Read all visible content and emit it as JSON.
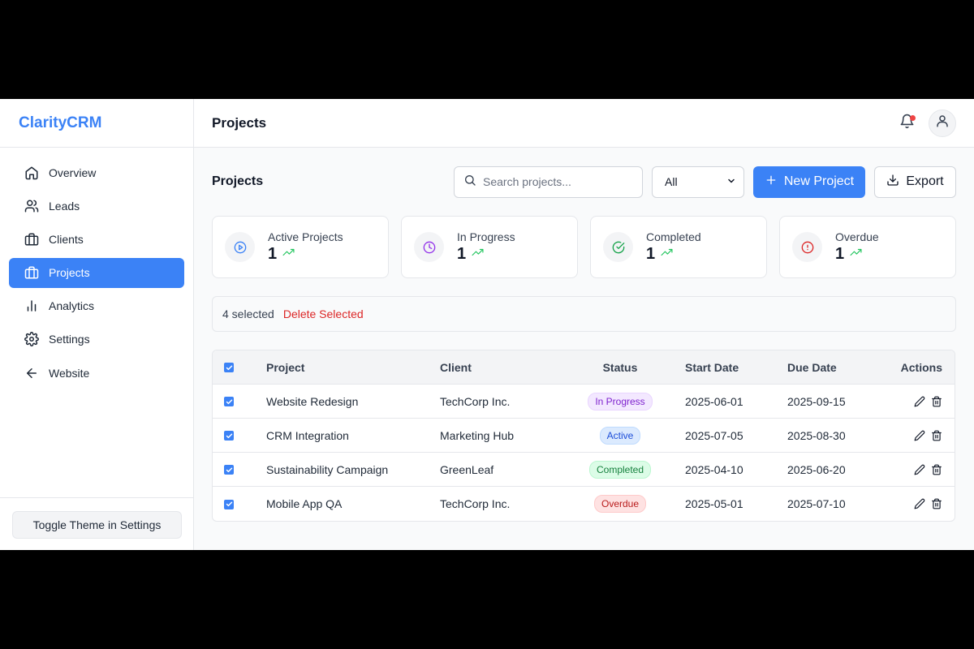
{
  "brand": "ClarityCRM",
  "nav": [
    {
      "label": "Overview",
      "icon": "home-icon"
    },
    {
      "label": "Leads",
      "icon": "users-icon"
    },
    {
      "label": "Clients",
      "icon": "briefcase-icon"
    },
    {
      "label": "Projects",
      "icon": "briefcase-icon",
      "active": true
    },
    {
      "label": "Analytics",
      "icon": "bar-chart-icon"
    },
    {
      "label": "Settings",
      "icon": "gear-icon"
    },
    {
      "label": "Website",
      "icon": "arrow-left-icon"
    }
  ],
  "sidebar_footer": {
    "theme_button": "Toggle Theme in Settings"
  },
  "header": {
    "title": "Projects"
  },
  "toolbar": {
    "title": "Projects",
    "search_placeholder": "Search projects...",
    "filter_value": "All",
    "new_project": "New Project",
    "export": "Export"
  },
  "stats": [
    {
      "label": "Active Projects",
      "value": "1",
      "icon": "play-circle-icon",
      "color": "#3b82f6"
    },
    {
      "label": "In Progress",
      "value": "1",
      "icon": "clock-icon",
      "color": "#9333ea"
    },
    {
      "label": "Completed",
      "value": "1",
      "icon": "check-circle-icon",
      "color": "#16a34a"
    },
    {
      "label": "Overdue",
      "value": "1",
      "icon": "alert-circle-icon",
      "color": "#dc2626"
    }
  ],
  "selection": {
    "count_text": "4 selected",
    "delete_label": "Delete Selected"
  },
  "table": {
    "headers": {
      "project": "Project",
      "client": "Client",
      "status": "Status",
      "start": "Start Date",
      "due": "Due Date",
      "actions": "Actions"
    },
    "rows": [
      {
        "project": "Website Redesign",
        "client": "TechCorp Inc.",
        "status": "In Progress",
        "start": "2025-06-01",
        "due": "2025-09-15"
      },
      {
        "project": "CRM Integration",
        "client": "Marketing Hub",
        "status": "Active",
        "start": "2025-07-05",
        "due": "2025-08-30"
      },
      {
        "project": "Sustainability Campaign",
        "client": "GreenLeaf",
        "status": "Completed",
        "start": "2025-04-10",
        "due": "2025-06-20"
      },
      {
        "project": "Mobile App QA",
        "client": "TechCorp Inc.",
        "status": "Overdue",
        "start": "2025-05-01",
        "due": "2025-07-10"
      }
    ]
  },
  "colors": {
    "accent": "#3b82f6",
    "danger": "#dc2626",
    "trend": "#22c55e"
  }
}
